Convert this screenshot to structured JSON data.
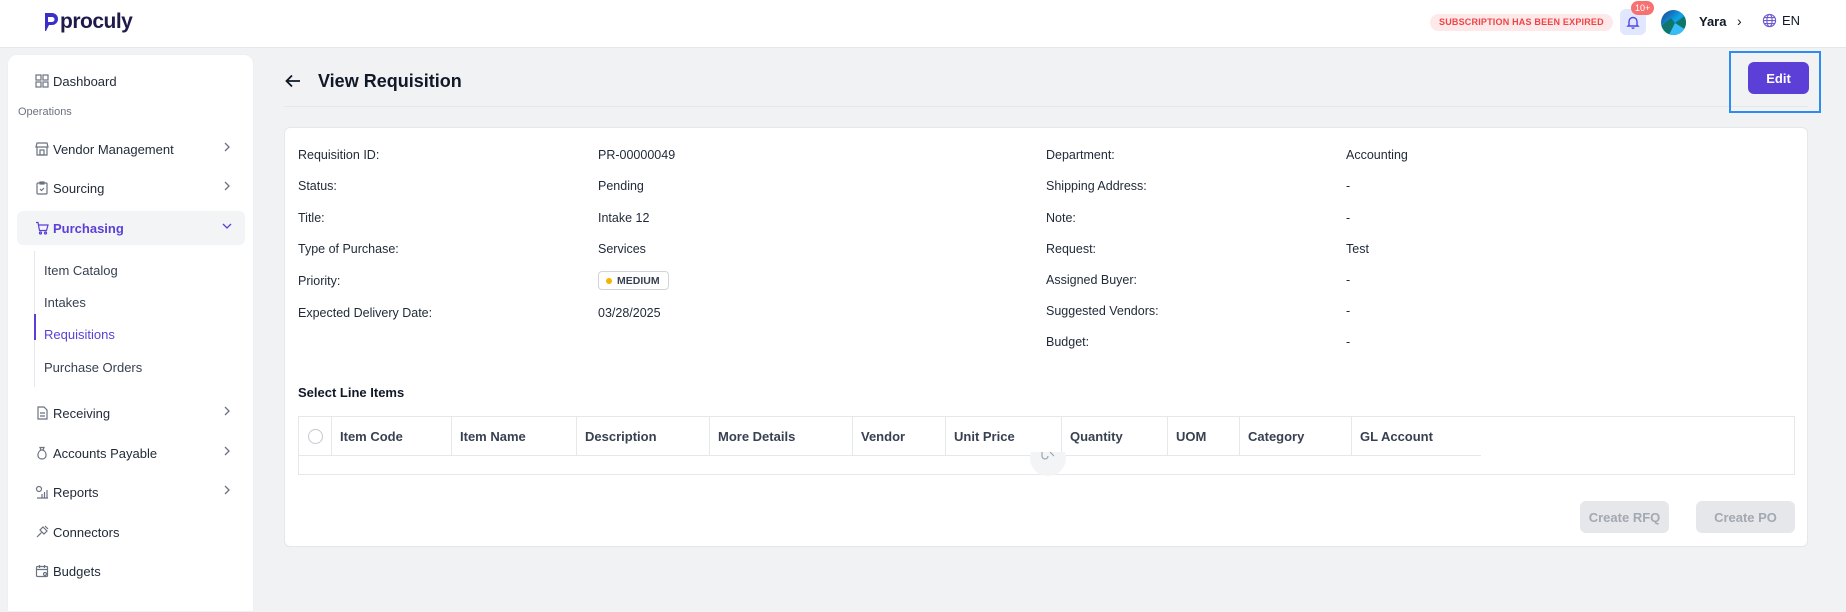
{
  "app": {
    "logo_text": "proculy"
  },
  "topbar": {
    "subscription_badge": "SUBSCRIPTION HAS BEEN EXPIRED",
    "notifications_count": "10+",
    "user_name": "Yara",
    "language": "EN"
  },
  "sidebar": {
    "dashboard": "Dashboard",
    "section_operations": "Operations",
    "vendor_management": "Vendor Management",
    "sourcing": "Sourcing",
    "purchasing": "Purchasing",
    "purchasing_sub": [
      "Item Catalog",
      "Intakes",
      "Requisitions",
      "Purchase Orders"
    ],
    "receiving": "Receiving",
    "accounts_payable": "Accounts Payable",
    "reports": "Reports",
    "connectors": "Connectors",
    "budgets": "Budgets"
  },
  "header": {
    "title": "View Requisition",
    "edit_label": "Edit"
  },
  "details_left": [
    {
      "label": "Requisition ID:",
      "value": "PR-00000049"
    },
    {
      "label": "Status:",
      "value": "Pending"
    },
    {
      "label": "Title:",
      "value": "Intake 12"
    },
    {
      "label": "Type of Purchase:",
      "value": "Services"
    },
    {
      "label": "Priority:",
      "value": "MEDIUM"
    },
    {
      "label": "Expected Delivery Date:",
      "value": "03/28/2025"
    }
  ],
  "details_right": [
    {
      "label": "Department:",
      "value": "Accounting"
    },
    {
      "label": "Shipping Address:",
      "value": "-"
    },
    {
      "label": "Note:",
      "value": "-"
    },
    {
      "label": "Request:",
      "value": "Test"
    },
    {
      "label": "Assigned Buyer:",
      "value": "-"
    },
    {
      "label": "Suggested Vendors:",
      "value": "-"
    },
    {
      "label": "Budget:",
      "value": "-"
    }
  ],
  "line_items": {
    "title": "Select Line Items",
    "columns": [
      "Item Code",
      "Item Name",
      "Description",
      "More Details",
      "Vendor",
      "Unit Price",
      "Quantity",
      "UOM",
      "Category",
      "GL Account"
    ]
  },
  "actions": {
    "create_rfq": "Create RFQ",
    "create_po": "Create PO"
  },
  "colors": {
    "accent": "#5b3fd6",
    "highlight_frame": "#2d8cf0",
    "priority_dot": "#f5b400",
    "expired_text": "#ef4444"
  }
}
